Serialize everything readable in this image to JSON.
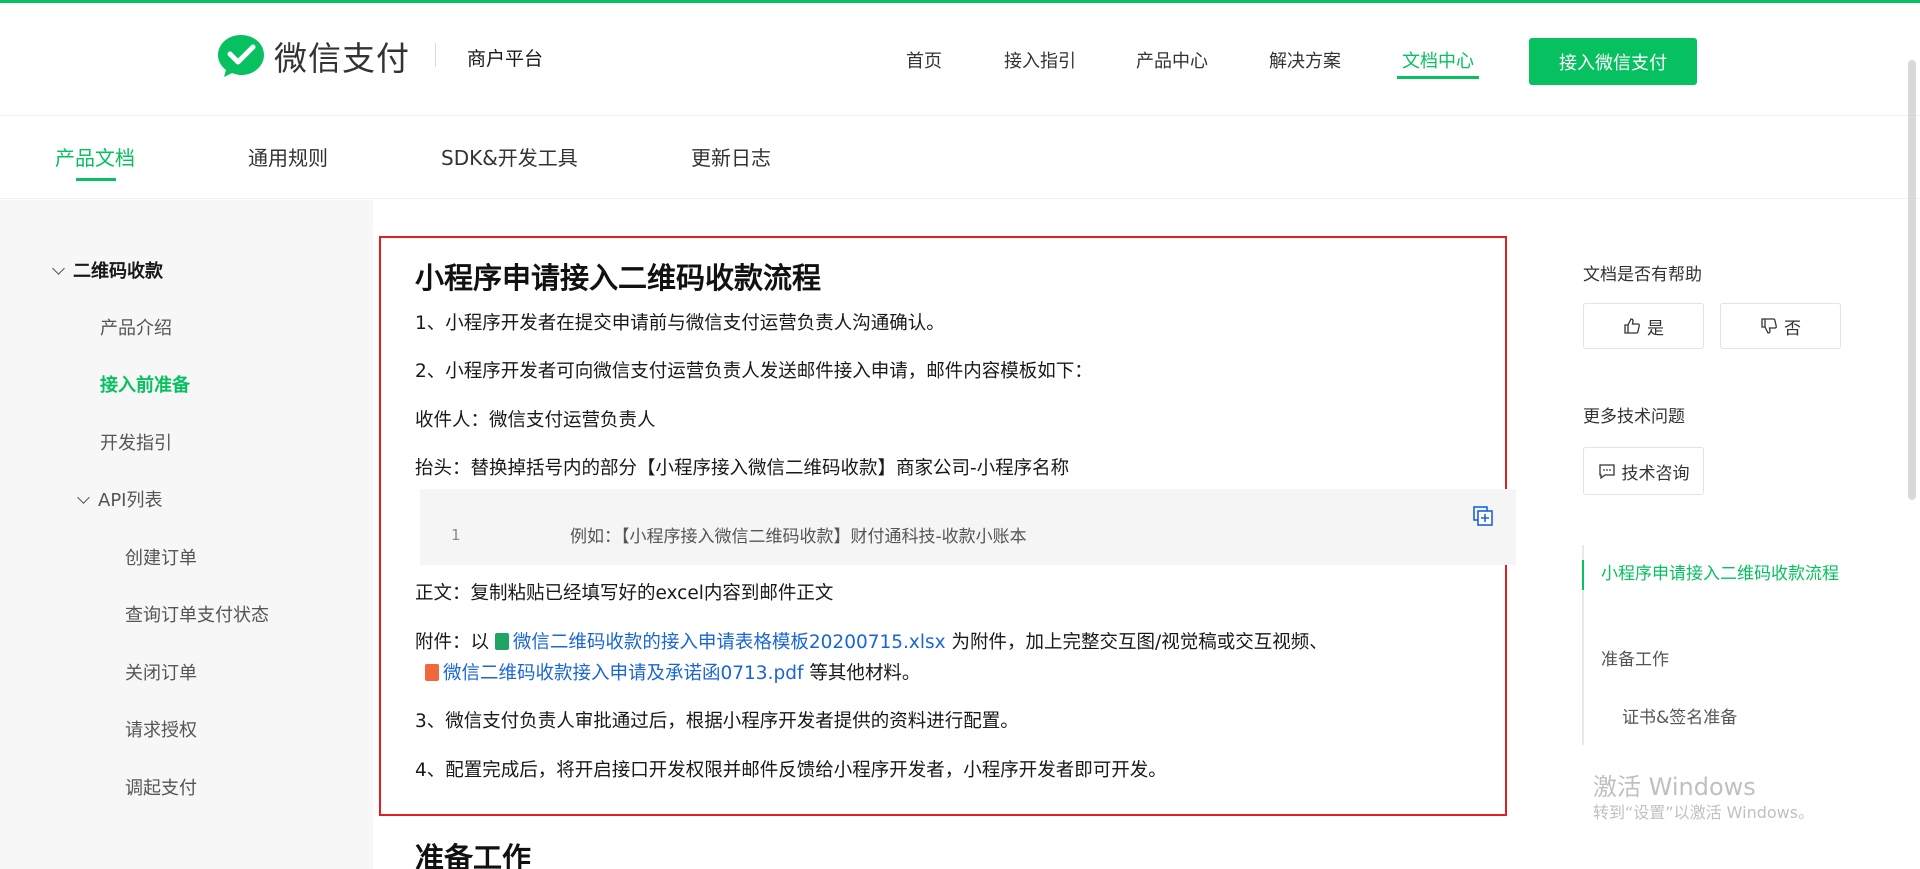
{
  "header": {
    "logo_text": "微信支付",
    "platform": "商户平台",
    "nav": [
      "首页",
      "接入指引",
      "产品中心",
      "解决方案",
      "文档中心"
    ],
    "active_nav": "文档中心",
    "cta": "接入微信支付"
  },
  "subnav": {
    "tabs": [
      "产品文档",
      "通用规则",
      "SDK&开发工具",
      "更新日志"
    ],
    "active": "产品文档"
  },
  "sidebar": {
    "group": "二维码收款",
    "items": [
      "产品介绍",
      "接入前准备",
      "开发指引"
    ],
    "active": "接入前准备",
    "api_group": "API列表",
    "api_items": [
      "创建订单",
      "查询订单支付状态",
      "关闭订单",
      "请求授权",
      "调起支付"
    ]
  },
  "doc": {
    "title": "小程序申请接入二维码收款流程",
    "p1": "1、小程序开发者在提交申请前与微信支付运营负责人沟通确认。",
    "p2": "2、小程序开发者可向微信支付运营负责人发送邮件接入申请，邮件内容模板如下：",
    "p3": "收件人：微信支付运营负责人",
    "p4": "抬头：替换掉括号内的部分【小程序接入微信二维码收款】商家公司-小程序名称",
    "code_line_no": "1",
    "code_text": "例如：【小程序接入微信二维码收款】财付通科技-收款小账本",
    "p5": "正文：复制粘贴已经填写好的excel内容到邮件正文",
    "p6_prefix": "附件：以 ",
    "attachment_xlsx": "微信二维码收款的接入申请表格模板20200715.xlsx",
    "p6_mid": " 为附件，加上完整交互图/视觉稿或交互视频、",
    "attachment_pdf": "微信二维码收款接入申请及承诺函0713.pdf",
    "p6_suffix": " 等其他材料。",
    "p7": "3、微信支付负责人审批通过后，根据小程序开发者提供的资料进行配置。",
    "p8": "4、配置完成后，将开启接口开发权限并邮件反馈给小程序开发者，小程序开发者即可开发。",
    "next_section": "准备工作"
  },
  "right": {
    "helpful_label": "文档是否有帮助",
    "yes": "是",
    "no": "否",
    "more_label": "更多技术问题",
    "consult": "技术咨询",
    "toc": [
      "小程序申请接入二维码收款流程",
      "准备工作",
      "证书&签名准备"
    ],
    "toc_active": "小程序申请接入二维码收款流程"
  },
  "watermark": {
    "line1": "激活 Windows",
    "line2": "转到“设置”以激活 Windows。"
  },
  "colors": {
    "brand": "#07c160",
    "highlight_border": "#e02020",
    "link": "#1a66d6"
  }
}
